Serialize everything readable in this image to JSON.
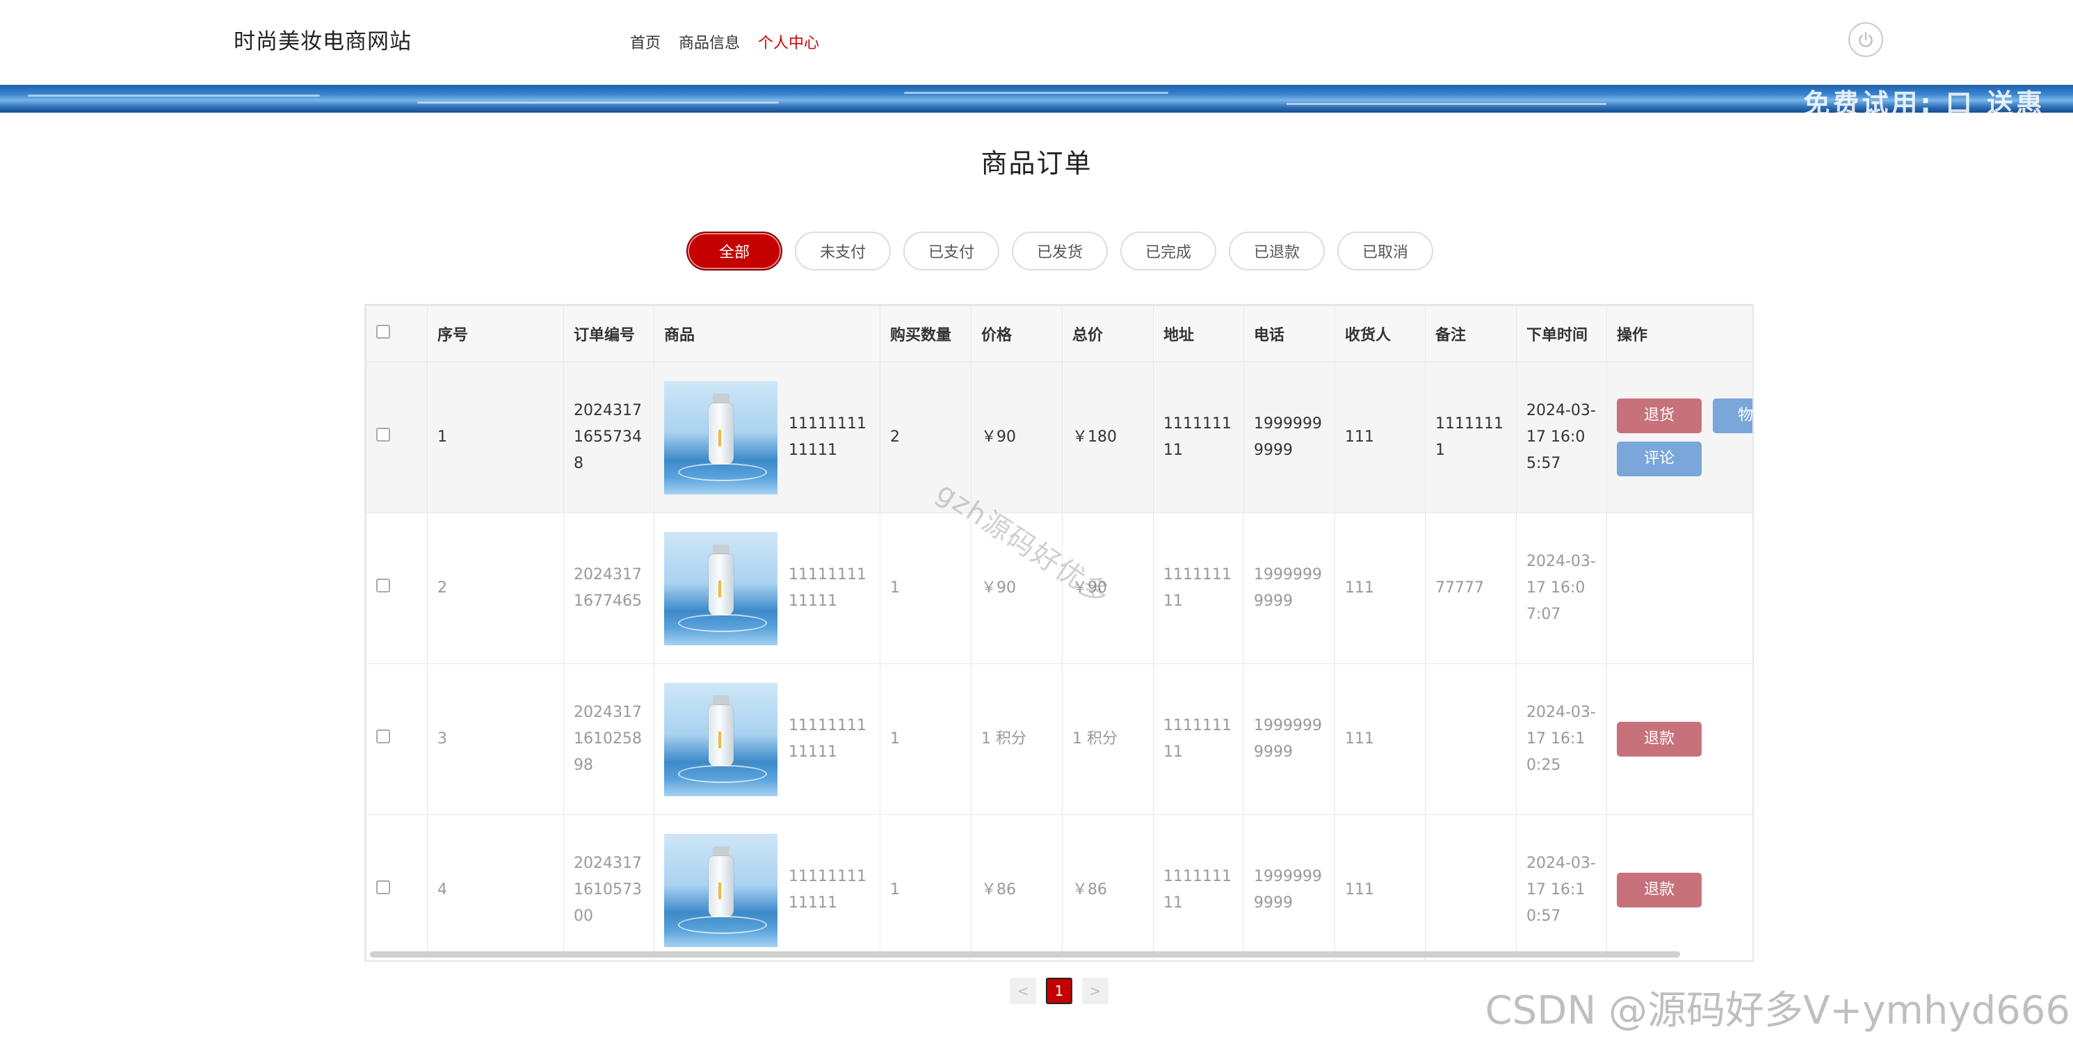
{
  "header": {
    "brand": "时尚美妆电商网站",
    "nav": [
      "首页",
      "商品信息",
      "个人中心"
    ],
    "active_nav_index": 2,
    "banner_text": "免费试用: 口 送惠",
    "power_icon": "power-icon"
  },
  "page": {
    "title": "商品订单"
  },
  "tabs": [
    "全部",
    "未支付",
    "已支付",
    "已发货",
    "已完成",
    "已退款",
    "已取消"
  ],
  "active_tab_index": 0,
  "table": {
    "headers": [
      "序号",
      "订单编号",
      "商品",
      "购买数量",
      "价格",
      "总价",
      "地址",
      "电话",
      "收货人",
      "备注",
      "下单时间",
      "操作"
    ],
    "rows": [
      {
        "index": "1",
        "order_no": "20243171655734 8",
        "goods": "1111111111111",
        "qty": "2",
        "price": "￥90",
        "total": "￥180",
        "address": "111111111",
        "phone": "19999999999",
        "receiver": "111",
        "note": "11111111",
        "time": "2024-03-17 16:05:57",
        "actions": [
          "退货",
          "评论"
        ],
        "partial_action": "物"
      },
      {
        "index": "2",
        "order_no": "20243171677465",
        "goods": "1111111111111",
        "qty": "1",
        "price": "￥90",
        "total": "￥90",
        "address": "111111111",
        "phone": "19999999999",
        "receiver": "111",
        "note": "77777",
        "time": "2024-03-17 16:07:07",
        "actions": []
      },
      {
        "index": "3",
        "order_no": "2024317161025898",
        "goods": "1111111111111",
        "qty": "1",
        "price": "1 积分",
        "total": "1 积分",
        "address": "111111111",
        "phone": "19999999999",
        "receiver": "111",
        "note": "",
        "time": "2024-03-17 16:10:25",
        "actions": [
          "退款"
        ]
      },
      {
        "index": "4",
        "order_no": "2024317161057300",
        "goods": "1111111111111",
        "qty": "1",
        "price": "￥86",
        "total": "￥86",
        "address": "111111111",
        "phone": "19999999999",
        "receiver": "111",
        "note": "",
        "time": "2024-03-17 16:10:57",
        "actions": [
          "退款"
        ]
      }
    ]
  },
  "pagination": {
    "prev": "<",
    "current": "1",
    "next": ">"
  },
  "overlays": {
    "diag_watermark": "gzh源码好优多",
    "csdn_watermark": "CSDN @源码好多V+ymhyd666"
  },
  "colors": {
    "accent_red": "#c40000",
    "refund_button": "#c7727b",
    "secondary_button": "#7aa6d9"
  }
}
